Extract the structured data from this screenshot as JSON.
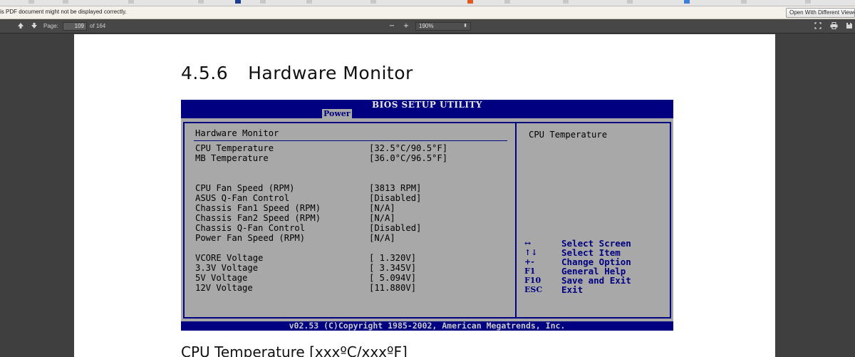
{
  "notification": {
    "message": "is PDF document might not be displayed correctly.",
    "open_button": "Open With Different Viewer"
  },
  "toolbar": {
    "prev_icon": "up-arrow-icon",
    "next_icon": "down-arrow-icon",
    "page_label": "Page:",
    "page_value": "109",
    "page_total": "of 164",
    "zoom_out": "−",
    "zoom_in": "+",
    "zoom_value": "190%"
  },
  "document": {
    "heading_number": "4.5.6",
    "heading_text": "Hardware Monitor",
    "next_heading": "CPU Temperature [xxxºC/xxxºF]"
  },
  "bios": {
    "title": "BIOS SETUP UTILITY",
    "active_tab": "Power",
    "section_title": "Hardware Monitor",
    "items": [
      {
        "label": "CPU Temperature",
        "value": "[32.5°C/90.5°F]"
      },
      {
        "label": "MB Temperature",
        "value": "[36.0°C/96.5°F]"
      },
      {
        "label": "CPU Fan Speed (RPM)",
        "value": "[3813 RPM]"
      },
      {
        "label": "ASUS Q-Fan Control",
        "value": "[Disabled]"
      },
      {
        "label": "Chassis Fan1 Speed (RPM)",
        "value": "[N/A]"
      },
      {
        "label": "Chassis Fan2 Speed (RPM)",
        "value": "[N/A]"
      },
      {
        "label": "Chassis Q-Fan Control",
        "value": "[Disabled]"
      },
      {
        "label": "Power Fan Speed (RPM)",
        "value": "[N/A]"
      },
      {
        "label": "VCORE Voltage",
        "value": "[ 1.320V]"
      },
      {
        "label": "3.3V Voltage",
        "value": "[ 3.345V]"
      },
      {
        "label": "5V Voltage",
        "value": "[ 5.094V]"
      },
      {
        "label": "12V Voltage",
        "value": "[11.880V]"
      }
    ],
    "help_text": "CPU Temperature",
    "keys": [
      {
        "key": "↔",
        "desc": "Select Screen"
      },
      {
        "key": "↑↓",
        "desc": "Select Item"
      },
      {
        "key": "+-",
        "desc": "Change Option"
      },
      {
        "key": "F1",
        "desc": "General Help"
      },
      {
        "key": "F10",
        "desc": "Save and Exit"
      },
      {
        "key": "ESC",
        "desc": "Exit"
      }
    ],
    "footer": "v02.53 (C)Copyright 1985-2002, American Megatrends, Inc."
  }
}
